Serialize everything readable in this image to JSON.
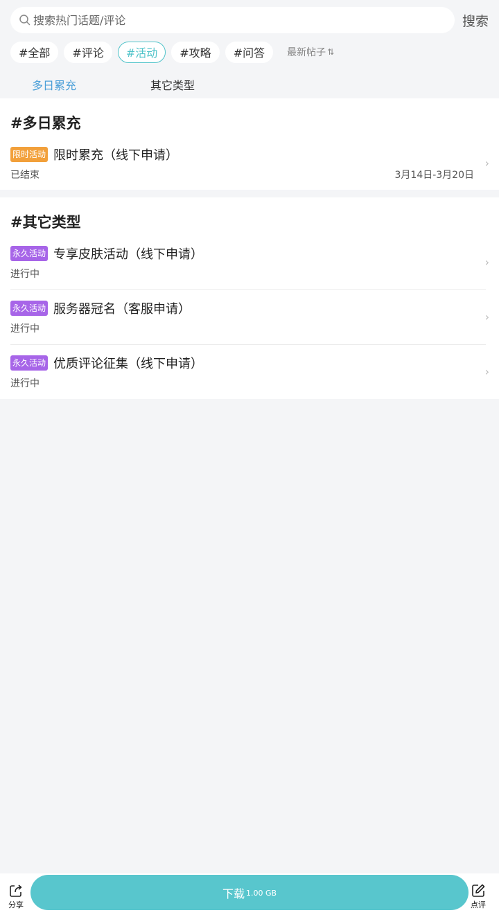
{
  "search": {
    "placeholder": "搜索热门话题/评论",
    "button_label": "搜索"
  },
  "tags": [
    {
      "label": "#全部",
      "active": false
    },
    {
      "label": "#评论",
      "active": false
    },
    {
      "label": "#活动",
      "active": true
    },
    {
      "label": "#攻略",
      "active": false
    },
    {
      "label": "#问答",
      "active": false
    }
  ],
  "sort": {
    "label": "最新帖子",
    "icon": "sort-arrows-icon"
  },
  "subtabs": [
    {
      "label": "多日累充",
      "active": true
    },
    {
      "label": "其它类型",
      "active": false
    }
  ],
  "sections": [
    {
      "title": "#多日累充",
      "items": [
        {
          "badge": "限时活动",
          "badge_color": "#f2a03b",
          "title": "限时累充（线下申请）",
          "status": "已结束",
          "date": "3月14日-3月20日"
        }
      ]
    },
    {
      "title": "#其它类型",
      "items": [
        {
          "badge": "永久活动",
          "badge_color": "#a765e8",
          "title": "专享皮肤活动（线下申请）",
          "status": "进行中"
        },
        {
          "badge": "永久活动",
          "badge_color": "#a765e8",
          "title": "服务器冠名（客服申请）",
          "status": "进行中"
        },
        {
          "badge": "永久活动",
          "badge_color": "#a765e8",
          "title": "优质评论征集（线下申请）",
          "status": "进行中"
        }
      ]
    }
  ],
  "bottom": {
    "share_label": "分享",
    "download_label": "下载",
    "download_size": "1.00 GB",
    "review_label": "点评",
    "accent_color": "#58c6cd"
  },
  "chevron": "›"
}
